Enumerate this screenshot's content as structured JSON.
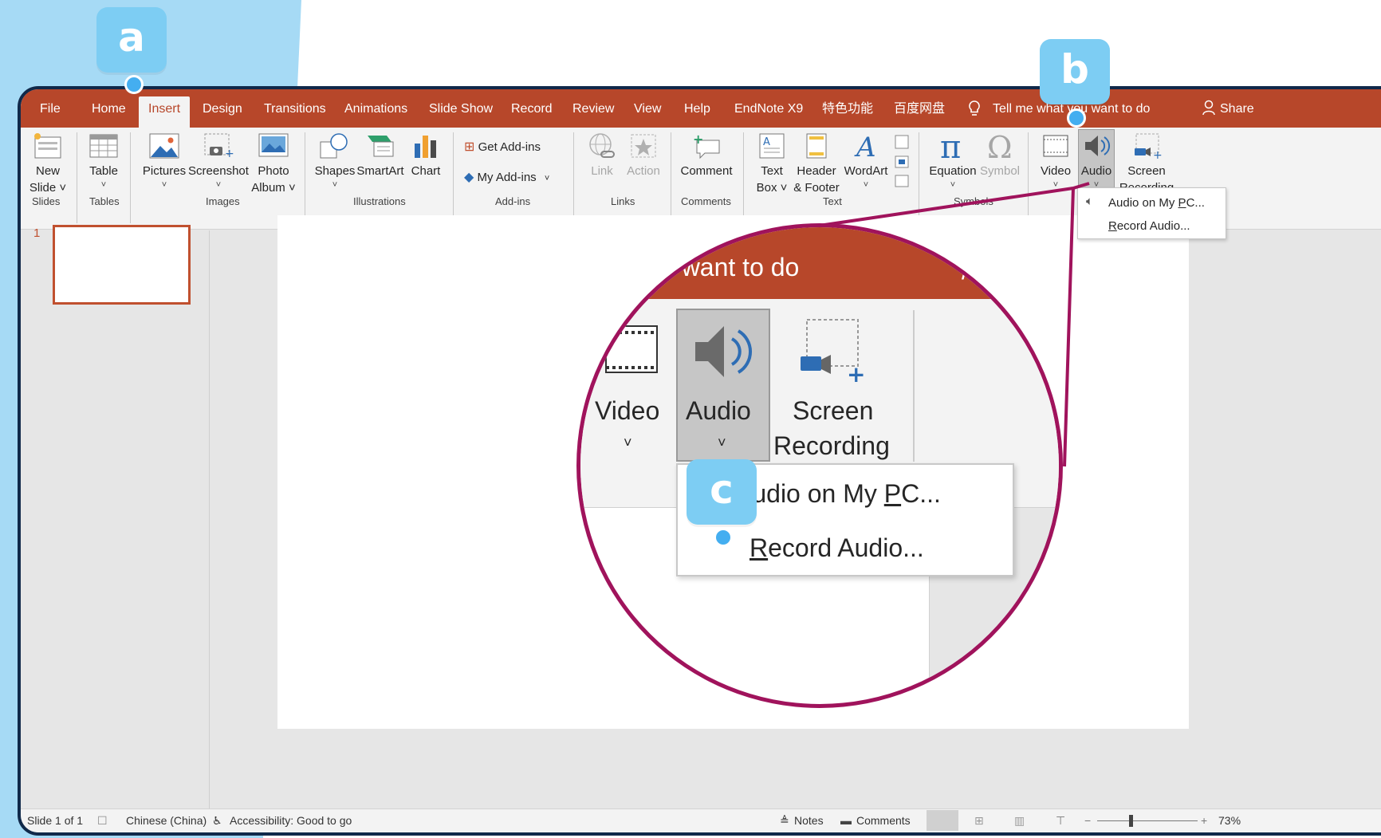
{
  "tabs": [
    "File",
    "Home",
    "Insert",
    "Design",
    "Transitions",
    "Animations",
    "Slide Show",
    "Record",
    "Review",
    "View",
    "Help",
    "EndNote X9",
    "特色功能",
    "百度网盘"
  ],
  "active_tab": "Insert",
  "tell_me": "Tell me what you want to do",
  "share": "Share",
  "ribbon": {
    "new_slide": [
      "New",
      "Slide ˅"
    ],
    "table": "Table",
    "pictures": "Pictures",
    "screenshot": "Screenshot",
    "photo_album": [
      "Photo",
      "Album ˅"
    ],
    "shapes": "Shapes",
    "smartart": "SmartArt",
    "chart": "Chart",
    "get_addins": "Get Add-ins",
    "my_addins": "My Add-ins",
    "link": "Link",
    "action": "Action",
    "comment": "Comment",
    "text_box": [
      "Text",
      "Box ˅"
    ],
    "header_footer": [
      "Header",
      "& Footer"
    ],
    "wordart": "WordArt",
    "equation": "Equation",
    "symbol": "Symbol",
    "video": "Video",
    "audio": "Audio",
    "screen_recording": [
      "Screen",
      "Recording"
    ]
  },
  "groups": [
    "Slides",
    "Tables",
    "Images",
    "Illustrations",
    "Add-ins",
    "Links",
    "Comments",
    "Text",
    "Symbols"
  ],
  "dropdown": {
    "item1_pre": "Audio on My ",
    "item1_u": "P",
    "item1_post": "C...",
    "item2_u": "R",
    "item2_post": "ecord Audio..."
  },
  "slide_number": "1",
  "status": {
    "slide": "Slide 1 of 1",
    "language": "Chinese (China)",
    "accessibility": "Accessibility: Good to go",
    "notes": "Notes",
    "comments": "Comments",
    "zoom": "73%"
  },
  "zoom_view": {
    "header_text": "u want to do",
    "video": "Video",
    "audio": "Audio",
    "screen": "Screen",
    "recording": "Recording",
    "item1_pre": "Audio on My ",
    "item1_u": "P",
    "item1_post": "C...",
    "item2_u": "R",
    "item2_post": "ecord Audio..."
  },
  "badges": {
    "a": "a",
    "b": "b",
    "c": "c"
  },
  "colors": {
    "accent": "#b7472a",
    "badge": "#7dcdf3",
    "badge_dot": "#44aef0",
    "magnifier": "#a0135c",
    "window_border": "#10294a"
  }
}
